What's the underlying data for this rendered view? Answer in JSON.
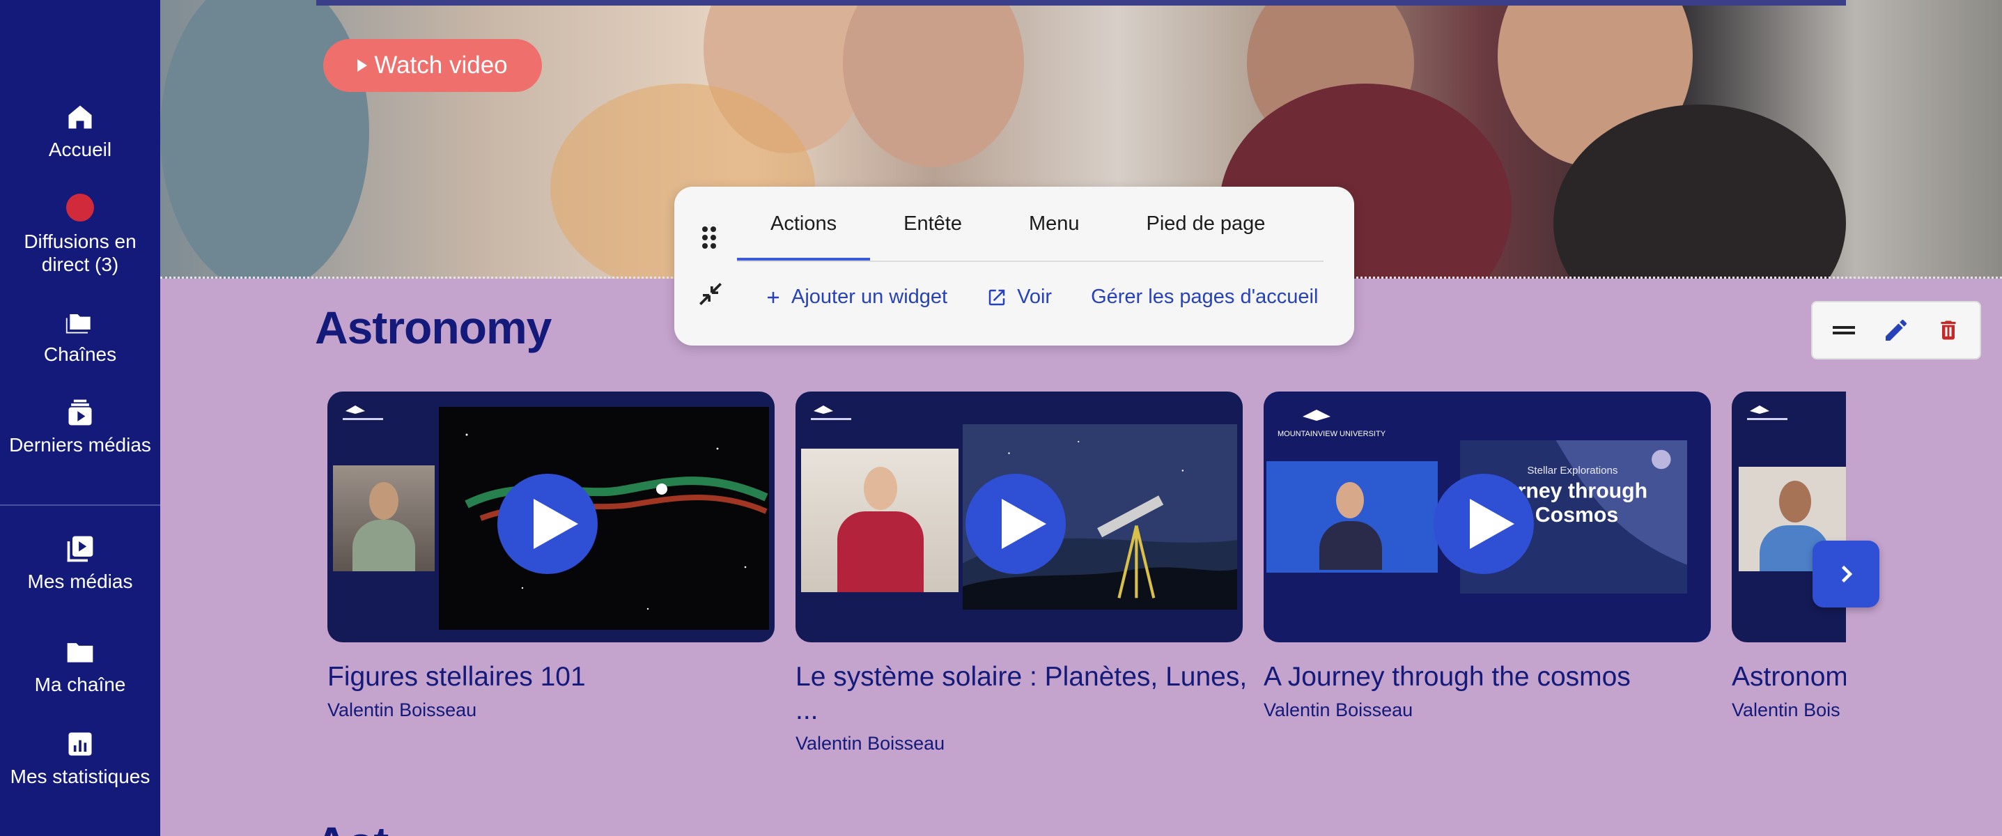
{
  "sidebar": {
    "items": [
      {
        "label": "Accueil",
        "icon": "home-icon"
      },
      {
        "label": "Diffusions en direct (3)",
        "icon": "live-dot-icon"
      },
      {
        "label": "Chaînes",
        "icon": "folders-icon"
      },
      {
        "label": "Derniers médias",
        "icon": "latest-media-icon"
      },
      {
        "label": "Mes médias",
        "icon": "my-media-icon"
      },
      {
        "label": "Ma chaîne",
        "icon": "folder-icon"
      },
      {
        "label": "Mes statistiques",
        "icon": "stats-icon"
      }
    ]
  },
  "hero": {
    "watch_label": "Watch video"
  },
  "toolbar": {
    "tabs": [
      "Actions",
      "Entête",
      "Menu",
      "Pied de page"
    ],
    "active_tab": "Actions",
    "actions": {
      "add_widget": "Ajouter un widget",
      "view": "Voir",
      "manage": "Gérer les pages d'accueil"
    }
  },
  "section": {
    "title": "Astronomy",
    "next_title": "Ast"
  },
  "cards": [
    {
      "title": "Figures stellaires 101",
      "author": "Valentin Boisseau"
    },
    {
      "title": "Le système solaire : Planètes, Lunes, ...",
      "author": "Valentin Boisseau"
    },
    {
      "title": "A Journey through the cosmos",
      "author": "Valentin Boisseau"
    },
    {
      "title": "Astronom",
      "author": "Valentin Bois"
    }
  ],
  "thumb_texts": {
    "journey_line1": "Stellar Explorations",
    "journey_line2": "rney through",
    "journey_line3": "e Cosmos",
    "university": "MOUNTAINVIEW UNIVERSITY"
  },
  "colors": {
    "sidebar": "#141a7a",
    "accent": "#2f4fd4",
    "background": "#c4a3cd",
    "watch_button": "#ef6f6c",
    "delete": "#c62828"
  }
}
